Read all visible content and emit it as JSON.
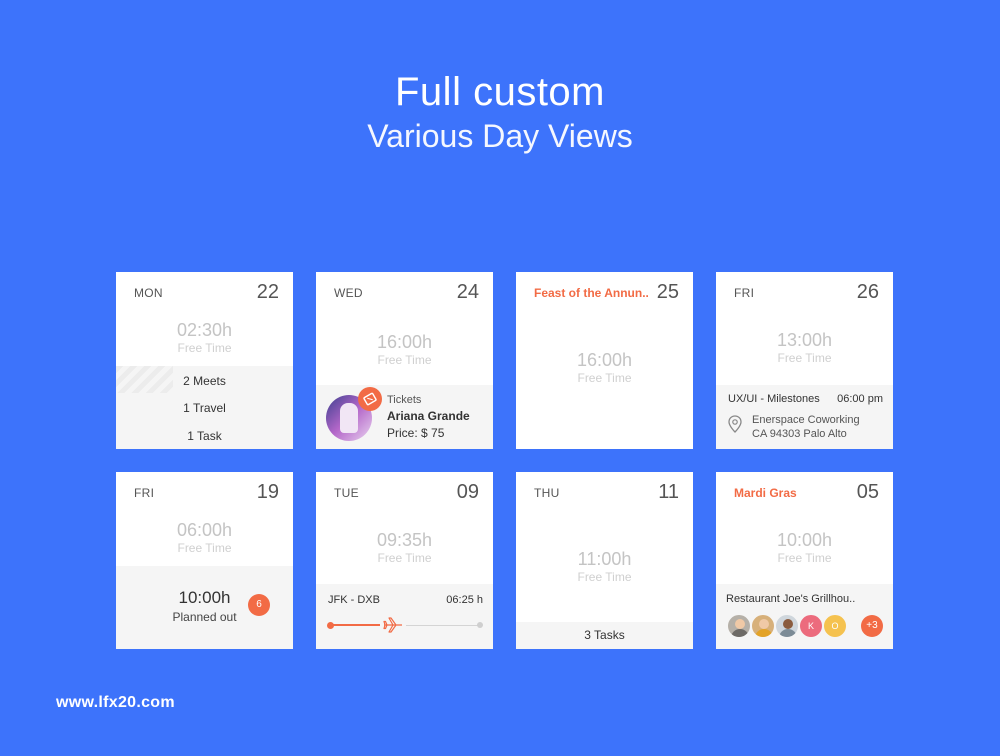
{
  "header": {
    "title": "Full custom",
    "subtitle": "Various Day Views"
  },
  "footer": {
    "watermark": "www.lfx20.com"
  },
  "colors": {
    "background": "#3d73fb",
    "accent": "#f26b45",
    "card": "#ffffff",
    "panel": "#f5f5f5"
  },
  "cards": {
    "mon": {
      "dow": "MON",
      "day": "22",
      "time": "02:30h",
      "caption": "Free Time",
      "rows": [
        "2 Meets",
        "1 Travel",
        "1 Task"
      ]
    },
    "wed": {
      "dow": "WED",
      "day": "24",
      "time": "16:00h",
      "caption": "Free Time",
      "event_label": "Tickets",
      "event_name": "Ariana Grande",
      "event_price": "Price: $ 75",
      "badge_icon": "ticket-icon"
    },
    "feast": {
      "holiday": "Feast of the Annun..",
      "day": "25",
      "time": "16:00h",
      "caption": "Free Time"
    },
    "fri26": {
      "dow": "FRI",
      "day": "26",
      "time": "13:00h",
      "caption": "Free Time",
      "event_title": "UX/UI - Milestones",
      "event_time": "06:00 pm",
      "location_line1": "Enerspace Coworking",
      "location_line2": "CA 94303 Palo Alto",
      "location_icon": "location-pin-icon"
    },
    "fri19": {
      "dow": "FRI",
      "day": "19",
      "time": "06:00h",
      "caption": "Free Time",
      "planned_time": "10:00h",
      "planned_label": "Planned out",
      "badge": "6"
    },
    "tue": {
      "dow": "TUE",
      "day": "09",
      "time": "09:35h",
      "caption": "Free Time",
      "route": "JFK - DXB",
      "duration": "06:25 h",
      "flight_icon": "airplane-icon",
      "progress": 0.36
    },
    "thu": {
      "dow": "THU",
      "day": "11",
      "time": "11:00h",
      "caption": "Free Time",
      "tasks": "3 Tasks"
    },
    "mardi": {
      "holiday": "Mardi Gras",
      "day": "05",
      "time": "10:00h",
      "caption": "Free Time",
      "place": "Restaurant Joe's Grillhou..",
      "initial_k": "K",
      "initial_o": "O",
      "more": "+3"
    }
  }
}
